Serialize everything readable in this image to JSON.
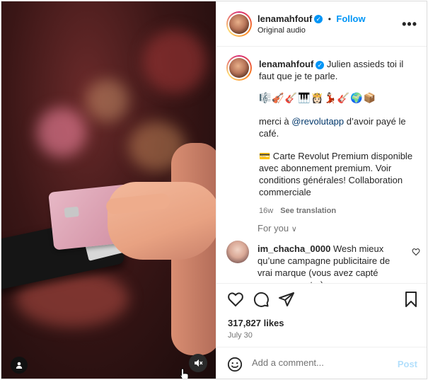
{
  "header": {
    "username": "lenamahfouf",
    "verified_mark": "✓",
    "follow_label": "Follow",
    "separator": "•",
    "audio_label": "Original audio",
    "more_label": "•••"
  },
  "caption": {
    "username": "lenamahfouf",
    "line1": "Julien assieds toi il faut que je te parle.",
    "emojis": "🎼🎻🎸🎹👸🏻💃🏻🎸🌍📦",
    "thanks_prefix": "merci à ",
    "thanks_mention": "@revolutapp",
    "thanks_suffix": " d’avoir payé le café.",
    "card_emoji": "💳",
    "promo": " Carte Revolut Premium disponible avec abonnement premium. Voir conditions générales! Collaboration commerciale",
    "time": "16w",
    "see_translation": "See translation"
  },
  "for_you": {
    "label": "For you",
    "chevron": "∨"
  },
  "comment": {
    "username": "im_chacha_0000",
    "text": "Wesh mieux qu’une campagne publicitaire de vrai marque (vous avez capté genre ceux ste )"
  },
  "actions": {
    "likes": "317,827 likes",
    "date": "July 30"
  },
  "add_comment": {
    "placeholder": "Add a comment...",
    "post_label": "Post"
  },
  "icons": [
    "user-tag-icon",
    "mute-icon",
    "heart-icon",
    "comment-icon",
    "share-icon",
    "bookmark-icon",
    "emoji-icon",
    "more-icon"
  ],
  "colors": {
    "link": "#0095f6",
    "mention": "#00376b",
    "muted": "#737373",
    "post_disabled": "#b2dffc"
  }
}
